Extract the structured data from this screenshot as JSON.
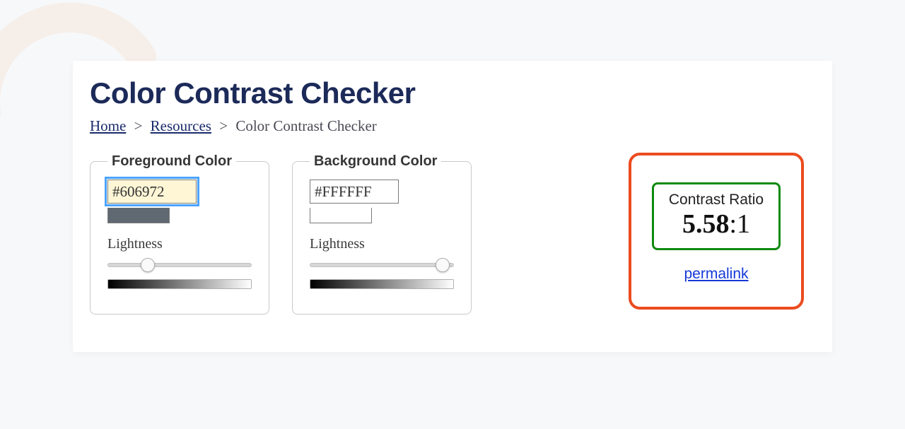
{
  "page": {
    "title": "Color Contrast Checker"
  },
  "breadcrumb": {
    "home": "Home",
    "resources": "Resources",
    "current": "Color Contrast Checker",
    "sep": ">"
  },
  "foreground": {
    "legend": "Foreground Color",
    "hex": "#606972",
    "swatch_color": "#606972",
    "lightness_label": "Lightness",
    "lightness_percent": 28
  },
  "background": {
    "legend": "Background Color",
    "hex": "#FFFFFF",
    "swatch_color": "#FFFFFF",
    "lightness_label": "Lightness",
    "lightness_percent": 92
  },
  "result": {
    "ratio_label": "Contrast Ratio",
    "ratio_value": "5.58",
    "ratio_suffix": ":1",
    "permalink_text": "permalink"
  }
}
